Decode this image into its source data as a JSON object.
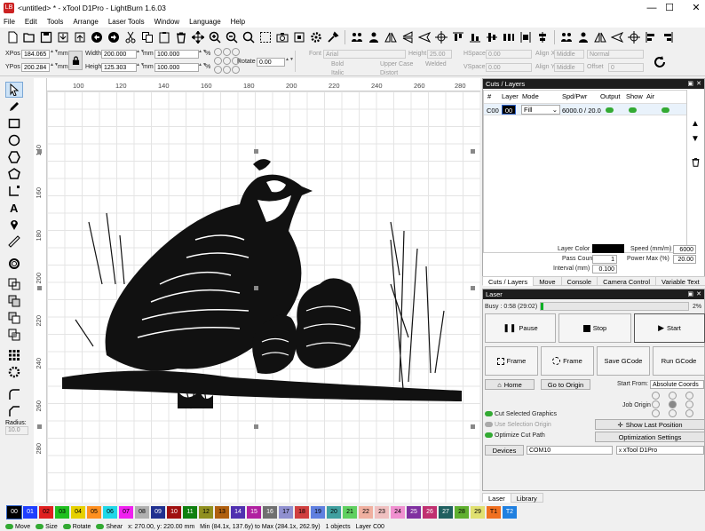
{
  "window": {
    "title": "<untitled> * - xTool D1Pro - LightBurn 1.6.03",
    "minimize": "—",
    "maximize": "☐",
    "close": "✕"
  },
  "menu": [
    "File",
    "Edit",
    "Tools",
    "Arrange",
    "Laser Tools",
    "Window",
    "Language",
    "Help"
  ],
  "pos": {
    "xpos_label": "XPos",
    "xpos": "184.065",
    "ypos_label": "YPos",
    "ypos": "200.284",
    "unit": "mm",
    "width_label": "Width",
    "width": "200.000",
    "height_label": "Height",
    "height": "125.303",
    "scale_w": "100.000",
    "scale_h": "100.000",
    "pct": "%",
    "rotate_label": "Rotate",
    "rotate": "0.00"
  },
  "font": {
    "font_label": "Font",
    "font": "Arial",
    "height_label": "Height",
    "height": "25.00",
    "hspace_label": "HSpace",
    "hspace": "0.00",
    "vspace_label": "VSpace",
    "vspace": "0.00",
    "alignx_label": "Align X",
    "alignx": "Middle",
    "aligny_label": "Align Y",
    "aligny": "Middle",
    "mode": "Normal",
    "offset_label": "Offset",
    "offset": "0",
    "bold": "Bold",
    "italic": "Italic",
    "upper": "Upper Case",
    "distort": "Distort",
    "welded": "Welded"
  },
  "ruler": {
    "top": [
      "100",
      "120",
      "140",
      "160",
      "180",
      "200",
      "220",
      "240",
      "260",
      "280"
    ],
    "left": [
      "140",
      "160",
      "180",
      "200",
      "220",
      "240",
      "260",
      "280"
    ]
  },
  "cuts": {
    "title": "Cuts / Layers",
    "headers": [
      "#",
      "Layer",
      "Mode",
      "Spd/Pwr",
      "Output",
      "Show",
      "Air"
    ],
    "row": {
      "num": "C00",
      "layer": "00",
      "mode": "Fill",
      "spdpwr": "6000.0 / 20.0"
    },
    "layer_color_label": "Layer Color",
    "pass_label": "Pass Count",
    "pass": "1",
    "interval_label": "Interval (mm)",
    "interval": "0.100",
    "speed_label": "Speed (mm/m)",
    "speed": "6000",
    "power_label": "Power Max (%)",
    "power": "20.00",
    "tabs": [
      "Cuts / Layers",
      "Move",
      "Console",
      "Camera Control",
      "Variable Text"
    ]
  },
  "laser": {
    "title": "Laser",
    "busy": "Busy : 0:58 (29:02)",
    "progress_pct": "2%",
    "progress": 0.02,
    "pause": "Pause",
    "stop": "Stop",
    "start": "Start",
    "frame1": "Frame",
    "frame2": "Frame",
    "save_gcode": "Save GCode",
    "run_gcode": "Run GCode",
    "home": "Home",
    "goto_origin": "Go to Origin",
    "start_from_label": "Start From:",
    "start_from": "Absolute Coords",
    "job_origin": "Job Origin",
    "cut_selected": "Cut Selected Graphics",
    "use_sel_origin": "Use Selection Origin",
    "optimize": "Optimize Cut Path",
    "show_last": "Show Last Position",
    "opt_settings": "Optimization Settings",
    "devices": "Devices",
    "port": "COM10",
    "device": "xTool D1Pro",
    "tabs": [
      "Laser",
      "Library"
    ]
  },
  "palette": [
    {
      "l": "00",
      "c": "#000000",
      "t": "#ffffff"
    },
    {
      "l": "01",
      "c": "#1f3fff",
      "t": "#ffffff"
    },
    {
      "l": "02",
      "c": "#e02020",
      "t": "#000000"
    },
    {
      "l": "03",
      "c": "#20c020",
      "t": "#000000"
    },
    {
      "l": "04",
      "c": "#e6d000",
      "t": "#000000"
    },
    {
      "l": "05",
      "c": "#ff9020",
      "t": "#000000"
    },
    {
      "l": "06",
      "c": "#20d8e8",
      "t": "#000000"
    },
    {
      "l": "07",
      "c": "#f020f0",
      "t": "#000000"
    },
    {
      "l": "08",
      "c": "#b0b0b0",
      "t": "#000000"
    },
    {
      "l": "09",
      "c": "#203090",
      "t": "#ffffff"
    },
    {
      "l": "10",
      "c": "#a01010",
      "t": "#ffffff"
    },
    {
      "l": "11",
      "c": "#108010",
      "t": "#ffffff"
    },
    {
      "l": "12",
      "c": "#909020",
      "t": "#000000"
    },
    {
      "l": "13",
      "c": "#b06010",
      "t": "#000000"
    },
    {
      "l": "14",
      "c": "#5030b0",
      "t": "#ffffff"
    },
    {
      "l": "15",
      "c": "#b020a0",
      "t": "#ffffff"
    },
    {
      "l": "16",
      "c": "#707070",
      "t": "#ffffff"
    },
    {
      "l": "17",
      "c": "#9090d0",
      "t": "#000000"
    },
    {
      "l": "18",
      "c": "#d04040",
      "t": "#000000"
    },
    {
      "l": "19",
      "c": "#6080e0",
      "t": "#000000"
    },
    {
      "l": "20",
      "c": "#40a0a0",
      "t": "#000000"
    },
    {
      "l": "21",
      "c": "#60d060",
      "t": "#000000"
    },
    {
      "l": "22",
      "c": "#f0b0a0",
      "t": "#000000"
    },
    {
      "l": "23",
      "c": "#f0c0c0",
      "t": "#000000"
    },
    {
      "l": "24",
      "c": "#f090d0",
      "t": "#000000"
    },
    {
      "l": "25",
      "c": "#8030a0",
      "t": "#ffffff"
    },
    {
      "l": "26",
      "c": "#c03070",
      "t": "#ffffff"
    },
    {
      "l": "27",
      "c": "#206060",
      "t": "#ffffff"
    },
    {
      "l": "28",
      "c": "#60b030",
      "t": "#000000"
    },
    {
      "l": "29",
      "c": "#e0e070",
      "t": "#000000"
    },
    {
      "l": "T1",
      "c": "#f07020",
      "t": "#000000"
    },
    {
      "l": "T2",
      "c": "#2080e0",
      "t": "#ffffff"
    }
  ],
  "status": {
    "move": "Move",
    "size": "Size",
    "rotate": "Rotate",
    "shear": "Shear",
    "coords": "x: 270.00, y: 220.00 mm",
    "minmax": "Min (84.1x, 137.6y) to Max (284.1x, 262.9y)",
    "objects": "1 objects",
    "layer": "Layer C00"
  },
  "left_tools": {
    "radius_label": "Radius:",
    "radius": "10.0"
  }
}
